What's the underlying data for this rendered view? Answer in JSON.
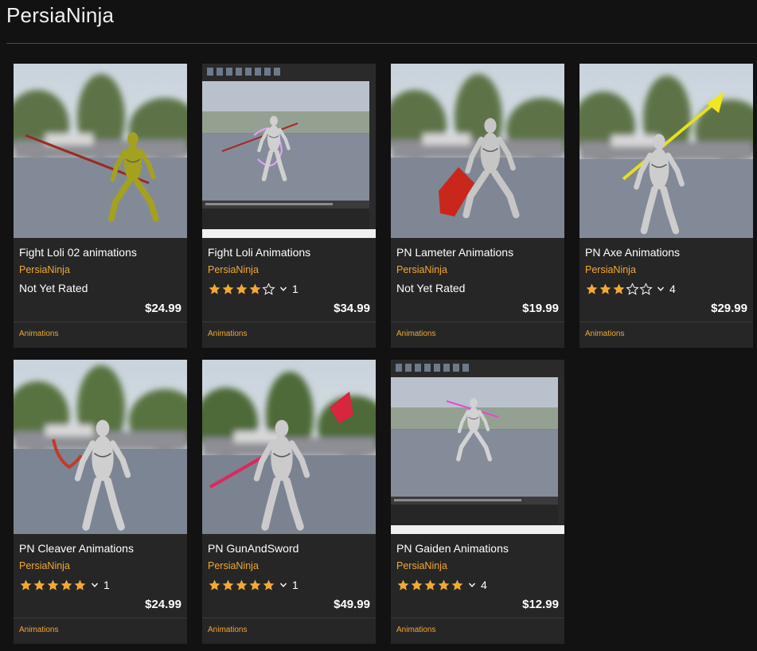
{
  "page": {
    "title": "PersiaNinja"
  },
  "colors": {
    "background": "#121212",
    "card": "#262626",
    "accent": "#f2a933",
    "text": "#ffffff",
    "star_filled": "#f2a933",
    "star_empty": "#ffffff"
  },
  "cards": [
    {
      "title": "Fight Loli 02 animations",
      "seller": "PersiaNinja",
      "rating_text": "Not Yet Rated",
      "stars": 0,
      "rating_count": "",
      "price": "$24.99",
      "category": "Animations",
      "thumb_icon": "yellow-mannequin-crouch-spear"
    },
    {
      "title": "Fight Loli Animations",
      "seller": "PersiaNinja",
      "rating_text": "",
      "stars": 4,
      "rating_count": "1",
      "price": "$34.99",
      "category": "Animations",
      "thumb_icon": "editor-mannequin-spear"
    },
    {
      "title": "PN Lameter Animations",
      "seller": "PersiaNinja",
      "rating_text": "Not Yet Rated",
      "stars": 0,
      "rating_count": "",
      "price": "$19.99",
      "category": "Animations",
      "thumb_icon": "mannequin-red-blade"
    },
    {
      "title": "PN Axe Animations",
      "seller": "PersiaNinja",
      "rating_text": "",
      "stars": 3,
      "rating_count": "4",
      "price": "$29.99",
      "category": "Animations",
      "thumb_icon": "mannequin-yellow-axe"
    },
    {
      "title": "PN Cleaver Animations",
      "seller": "PersiaNinja",
      "rating_text": "",
      "stars": 5,
      "rating_count": "1",
      "price": "$24.99",
      "category": "Animations",
      "thumb_icon": "mannequin-cleaver"
    },
    {
      "title": "PN GunAndSword",
      "seller": "PersiaNinja",
      "rating_text": "",
      "stars": 5,
      "rating_count": "1",
      "price": "$49.99",
      "category": "Animations",
      "thumb_icon": "mannequin-gun-sword"
    },
    {
      "title": "PN Gaiden Animations",
      "seller": "PersiaNinja",
      "rating_text": "",
      "stars": 5,
      "rating_count": "4",
      "price": "$12.99",
      "category": "Animations",
      "thumb_icon": "editor-mannequin-pink-blade"
    }
  ]
}
